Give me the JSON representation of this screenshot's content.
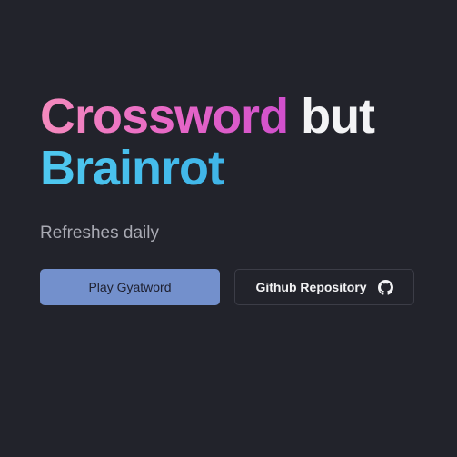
{
  "headline": {
    "word_1": "Crossword",
    "word_2": "but",
    "word_3": "Brainrot"
  },
  "tagline": "Refreshes daily",
  "buttons": {
    "play_label": "Play Gyatword",
    "github_label": "Github Repository",
    "github_icon": "github-icon"
  },
  "colors": {
    "background": "#22232b",
    "crossword_gradient": [
      "#f58bbd",
      "#d04fcc"
    ],
    "brainrot_gradient": [
      "#4fc9f0",
      "#3fb4e8"
    ],
    "play_button": "#7390cc"
  }
}
